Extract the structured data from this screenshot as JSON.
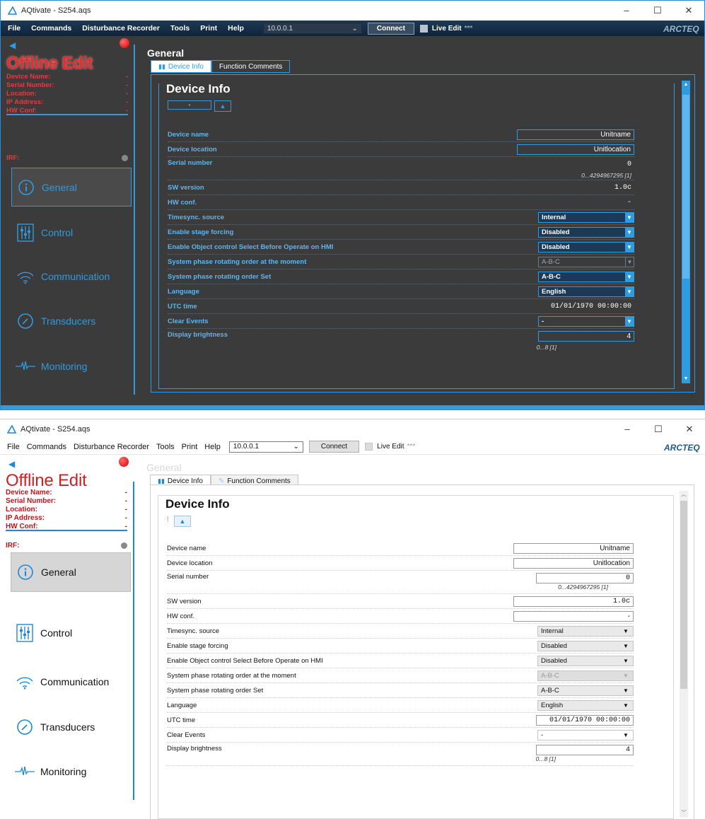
{
  "window": {
    "title": "AQtivate - S254.aqs",
    "controls": [
      "–",
      "☐",
      "✕"
    ]
  },
  "menu": {
    "items": [
      "File",
      "Commands",
      "Disturbance Recorder",
      "Tools",
      "Print",
      "Help"
    ],
    "ip": "10.0.0.1",
    "connect": "Connect",
    "live_edit": "Live Edit",
    "stars": "***",
    "brand": "ARCTEQ"
  },
  "sidebar": {
    "title": "Offline Edit",
    "info": [
      {
        "label": "Device Name:",
        "value": "-"
      },
      {
        "label": "Serial Number:",
        "value": "-"
      },
      {
        "label": "Location:",
        "value": "-"
      },
      {
        "label": "IP Address:",
        "value": "-"
      },
      {
        "label": "HW Conf:",
        "value": "-"
      }
    ],
    "irf_label": "IRF:",
    "nav": [
      "General",
      "Control",
      "Communication",
      "Transducers",
      "Monitoring"
    ]
  },
  "main": {
    "section": "General",
    "tabs": [
      "Device Info",
      "Function Comments"
    ],
    "panel_title": "Device Info",
    "dark_btn": "-",
    "rows": [
      {
        "label": "Device name",
        "value": "Unitname"
      },
      {
        "label": "Device location",
        "value": "Unitlocation"
      },
      {
        "label": "Serial number",
        "value": "0",
        "range": "0...4294967295 [1]"
      },
      {
        "label": "SW version",
        "value": "1.0c"
      },
      {
        "label": "HW conf.",
        "value": "-"
      },
      {
        "label": "Timesync. source",
        "value": "Internal"
      },
      {
        "label": "Enable stage forcing",
        "value": "Disabled"
      },
      {
        "label": "Enable Object control Select Before Operate on HMI",
        "value": "Disabled"
      },
      {
        "label": "System phase rotating order at the moment",
        "value": "A-B-C"
      },
      {
        "label": "System phase rotating order Set",
        "value": "A-B-C"
      },
      {
        "label": "Language",
        "value": "English"
      },
      {
        "label": "UTC time",
        "value": "01/01/1970 00:00:00"
      },
      {
        "label": "Clear Events",
        "value": "-"
      },
      {
        "label": "Display brightness",
        "value": "4",
        "range": "0...8 [1]"
      }
    ]
  },
  "colors": {
    "accent": "#2f9be0",
    "offline_red": "#d22020",
    "dark_bg": "#3b3b3b"
  }
}
